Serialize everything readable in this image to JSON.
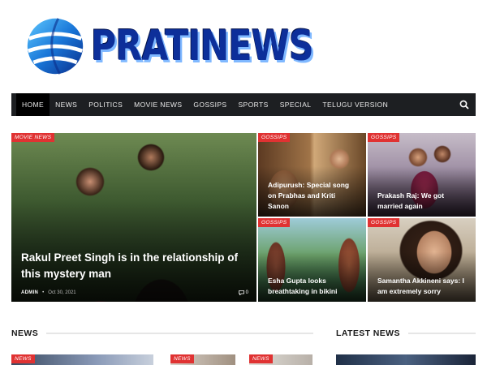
{
  "logo": {
    "text": "PRATINEWS"
  },
  "nav": {
    "items": [
      "HOME",
      "NEWS",
      "POLITICS",
      "MOVIE NEWS",
      "GOSSIPS",
      "SPORTS",
      "SPECIAL",
      "TELUGU VERSION"
    ]
  },
  "hero": {
    "main": {
      "category": "MOVIE NEWS",
      "title": "Rakul Preet Singh is in the relationship of this mystery man",
      "author": "ADMIN",
      "date": "Oct 30, 2021",
      "comments": "0"
    },
    "tiles": [
      {
        "category": "GOSSIPS",
        "title": "Adipurush: Special song on Prabhas and Kriti Sanon"
      },
      {
        "category": "GOSSIPS",
        "title": "Prakash Raj: We got married again"
      },
      {
        "category": "GOSSIPS",
        "title": "Esha Gupta looks breathtaking in bikini"
      },
      {
        "category": "GOSSIPS",
        "title": "Samantha Akkineni says: I am extremely sorry"
      }
    ]
  },
  "sections": {
    "news": "NEWS",
    "latest": "LATEST NEWS"
  },
  "thumbs": [
    "NEWS",
    "NEWS",
    "NEWS"
  ],
  "colors": {
    "accent": "#e03232",
    "nav_bg": "#1d1f22",
    "logo_blue": "#0d2f9a"
  }
}
